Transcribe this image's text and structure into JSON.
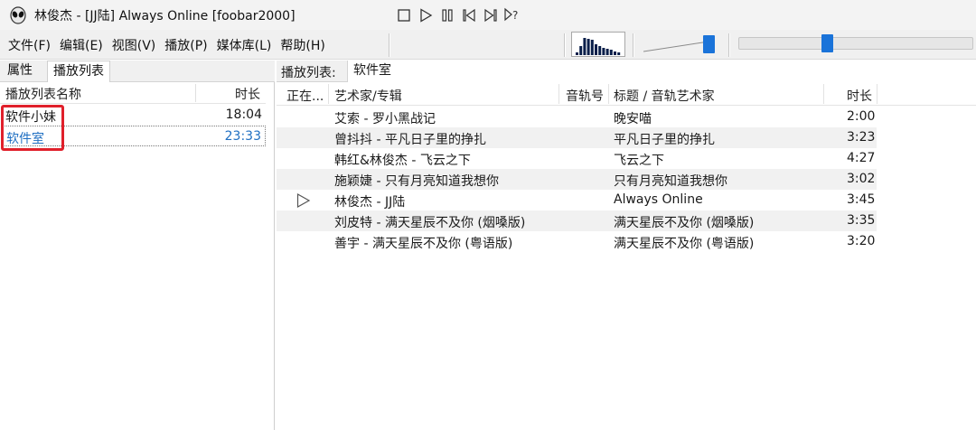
{
  "window": {
    "title": "林俊杰 - [JJ陆] Always Online  [foobar2000]",
    "app_icon": "alien-icon"
  },
  "menu": [
    "文件(F)",
    "编辑(E)",
    "视图(V)",
    "播放(P)",
    "媒体库(L)",
    "帮助(H)"
  ],
  "transport": {
    "buttons": [
      "stop-icon",
      "play-icon",
      "pause-icon",
      "previous-icon",
      "next-icon",
      "random-icon"
    ]
  },
  "spectrum": {
    "levels": [
      0.15,
      0.45,
      0.85,
      0.8,
      0.75,
      0.55,
      0.45,
      0.35,
      0.3,
      0.25,
      0.2,
      0.15
    ]
  },
  "volume": {
    "level": 0.9
  },
  "seek": {
    "position": 0.37
  },
  "left_tabs": [
    "属性",
    "播放列表"
  ],
  "playlist_manager": {
    "header_name": "播放列表名称",
    "header_duration": "时长",
    "items": [
      {
        "name": "软件小妹",
        "duration": "18:04"
      },
      {
        "name": "软件室",
        "duration": "23:33"
      }
    ]
  },
  "active_playlist": {
    "label": "播放列表:",
    "name": "软件室"
  },
  "columns": {
    "now_playing": "正在...",
    "artist_album": "艺术家/专辑",
    "track_no": "音轨号",
    "title_artist": "标题 / 音轨艺术家",
    "duration": "时长"
  },
  "tracks": [
    {
      "artist_album": "艾索 - 罗小黑战记",
      "title": "晚安喵",
      "duration": "2:00"
    },
    {
      "artist_album": "曾抖抖 - 平凡日子里的挣扎",
      "title": "平凡日子里的挣扎",
      "duration": "3:23"
    },
    {
      "artist_album": "韩红&林俊杰 - 飞云之下",
      "title": "飞云之下",
      "duration": "4:27"
    },
    {
      "artist_album": "施颖婕 - 只有月亮知道我想你",
      "title": "只有月亮知道我想你",
      "duration": "3:02"
    },
    {
      "artist_album": "林俊杰 - JJ陆",
      "title": "Always Online",
      "duration": "3:45",
      "playing": true
    },
    {
      "artist_album": "刘皮特 - 满天星辰不及你 (烟嗓版)",
      "title": "满天星辰不及你 (烟嗓版)",
      "duration": "3:35"
    },
    {
      "artist_album": "善宇 - 满天星辰不及你 (粤语版)",
      "title": "满天星辰不及你 (粤语版)",
      "duration": "3:20"
    }
  ],
  "colors": {
    "accent": "#1a73d9",
    "selection_text": "#1f6fc2",
    "highlight_box": "#e0202b"
  }
}
